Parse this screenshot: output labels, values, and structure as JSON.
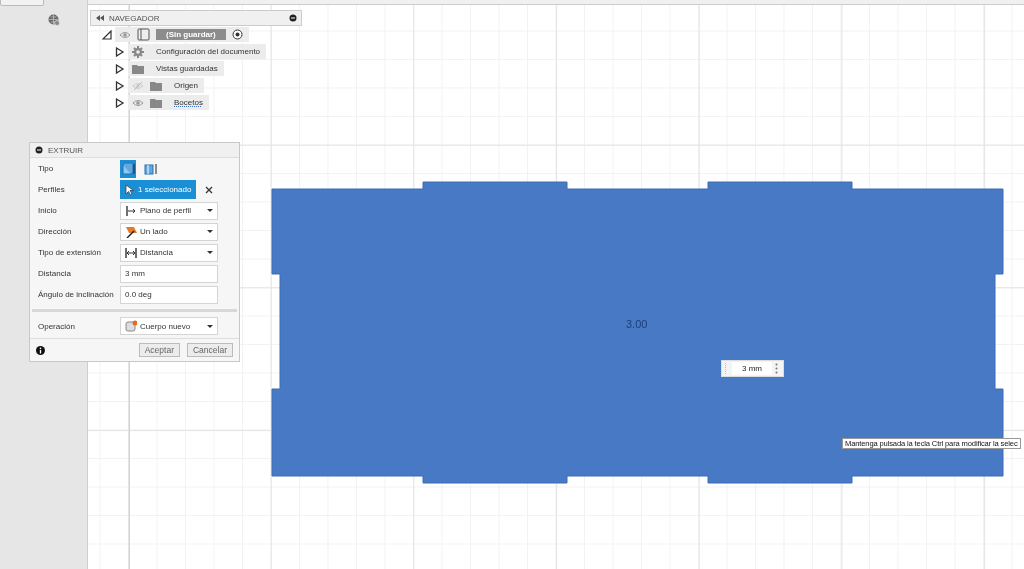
{
  "navigator": {
    "title": "NAVEGADOR",
    "root": {
      "label": "(Sin guardar)",
      "expanded": true,
      "visible": true,
      "children": [
        {
          "label": "Configuración del documento",
          "kind": "settings",
          "expanded": false
        },
        {
          "label": "Vistas guardadas",
          "kind": "folder",
          "expanded": false
        },
        {
          "label": "Origen",
          "kind": "folder",
          "expanded": false,
          "visible": false
        },
        {
          "label": "Bocetos",
          "kind": "sketches",
          "expanded": false,
          "visible": true
        }
      ]
    }
  },
  "extrude_dialog": {
    "title": "EXTRUIR",
    "rows": [
      {
        "label": "Tipo",
        "kind": "type",
        "options": [
          {
            "selected": true
          },
          {
            "selected": false
          }
        ]
      },
      {
        "label": "Perfiles",
        "kind": "selection",
        "value": "1 seleccionado"
      },
      {
        "label": "Inicio",
        "kind": "dropdown",
        "value": "Plano de perfil"
      },
      {
        "label": "Dirección",
        "kind": "dropdown",
        "value": "Un lado"
      },
      {
        "label": "Tipo de extensión",
        "kind": "dropdown",
        "value": "Distancia"
      },
      {
        "label": "Distancia",
        "kind": "input",
        "value": "3 mm"
      },
      {
        "label": "Ángulo de inclinación",
        "kind": "input",
        "value": "0.0 deg"
      },
      {
        "kind": "separator"
      },
      {
        "label": "Operación",
        "kind": "dropdown",
        "value": "Cuerpo nuevo"
      }
    ],
    "buttons": [
      "Aceptar",
      "Cancelar"
    ]
  },
  "canvas": {
    "dimension_label": "3.00",
    "distance_input": "3 mm",
    "tooltip": "Mantenga pulsada la tecla Ctrl para modificar la selec"
  }
}
